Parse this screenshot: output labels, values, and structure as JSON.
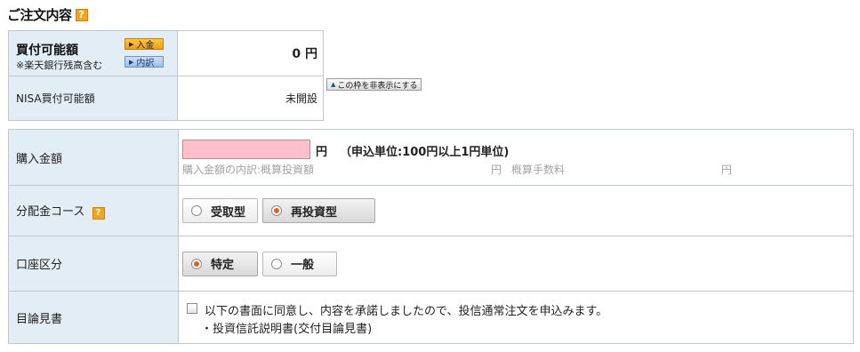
{
  "header": {
    "title": "ご注文内容",
    "help_icon": "?"
  },
  "summary": {
    "buying_power_label": "買付可能額",
    "buying_power_note": "※楽天銀行残高含む",
    "deposit_button": "入金",
    "detail_button": "内訳",
    "buying_power_value": "0 円",
    "nisa_label": "NISA買付可能額",
    "nisa_value": "未開設",
    "hide_button": "この枠を非表示にする"
  },
  "form": {
    "purchase_amount": {
      "label": "購入金額",
      "input_value": "",
      "unit": "円",
      "note": "（申込単位:100円以上1円単位)",
      "breakdown_label": "購入金額の内訳:概算投資額",
      "breakdown_yen1": "円",
      "breakdown_fee_label": "概算手数料",
      "breakdown_yen2": "円"
    },
    "distribution_course": {
      "label": "分配金コース",
      "help_icon": "?",
      "options": [
        "受取型",
        "再投資型"
      ],
      "selected": "再投資型"
    },
    "account_type": {
      "label": "口座区分",
      "options": [
        "特定",
        "一般"
      ],
      "selected": "特定"
    },
    "prospectus": {
      "label": "目論見書",
      "agree_text": "以下の書面に同意し、内容を承諾しましたので、投信通常注文を申込みます。",
      "document": "・投資信託説明書(交付目論見書)"
    }
  },
  "colors": {
    "label_bg": "#e2edf6",
    "input_bg": "#ffc0cb",
    "help_icon": "#f5a51c",
    "radio_selected": "#e8601c"
  }
}
